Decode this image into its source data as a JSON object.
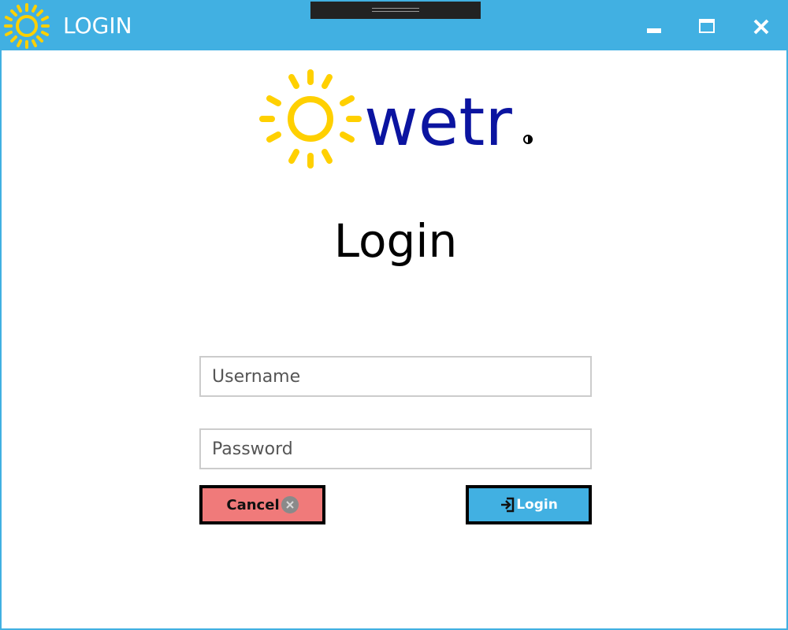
{
  "window": {
    "title": "LOGIN",
    "title_icon": "sun-icon",
    "controls": [
      "minimize-icon",
      "maximize-icon",
      "close-icon"
    ],
    "accent_color": "#41b0e2"
  },
  "logo": {
    "text": "wetr",
    "icon": "sun-icon",
    "sun_color": "#ffd000",
    "text_color": "#0b14a0"
  },
  "heading": "Login",
  "form": {
    "username_placeholder": "Username",
    "password_placeholder": "Password"
  },
  "buttons": {
    "cancel_label": "Cancel",
    "cancel_icon": "close-circle-icon",
    "cancel_color": "#f07a7a",
    "login_label": "Login",
    "login_icon": "sign-in-icon",
    "login_color": "#41b0e2"
  }
}
